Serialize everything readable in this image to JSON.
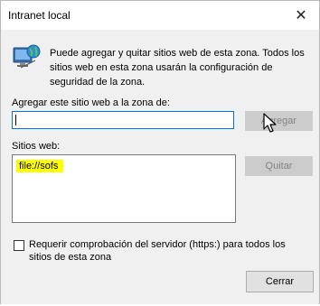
{
  "window": {
    "title": "Intranet local",
    "close_icon": "close-icon"
  },
  "zone": {
    "icon": "intranet-zone-icon",
    "description": "Puede agregar y quitar sitios web de esta zona. Todos los sitios web en esta zona usarán la configuración de seguridad de la zona."
  },
  "add_section": {
    "label": "Agregar este sitio web a la zona de:",
    "input_value": "",
    "add_button": "Agregar"
  },
  "sites_section": {
    "label": "Sitios web:",
    "sites": [
      "file://sofs"
    ],
    "remove_button": "Quitar"
  },
  "https_option": {
    "checked": false,
    "label": "Requerir comprobación del servidor (https:) para todos los sitios de esta zona"
  },
  "footer": {
    "close_button": "Cerrar"
  }
}
